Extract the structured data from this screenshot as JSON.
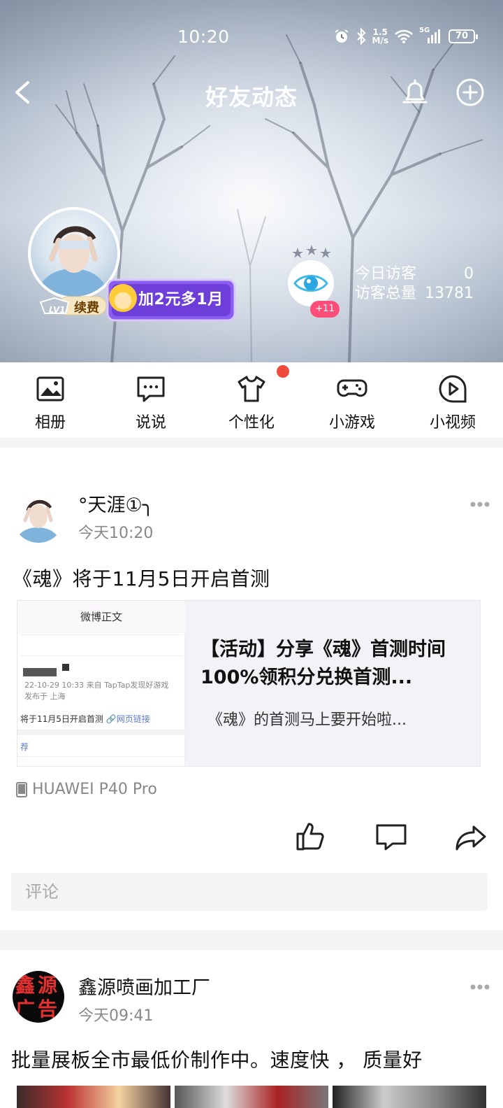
{
  "status_bar": {
    "time": "10:20",
    "speed_value": "1.5",
    "speed_unit": "M/s",
    "network": "5G",
    "battery": "70"
  },
  "nav": {
    "title": "好友动态"
  },
  "profile": {
    "level": "LV1",
    "renew_label": "续费",
    "promo_label": "加2元多1月",
    "visitor_plus": "+11",
    "today_visits_label": "今日访客",
    "today_visits_value": "0",
    "total_visits_label": "访客总量",
    "total_visits_value": "13781"
  },
  "quick_menu": [
    {
      "label": "相册",
      "icon": "photo-album-icon"
    },
    {
      "label": "说说",
      "icon": "chat-bubble-icon"
    },
    {
      "label": "个性化",
      "icon": "tshirt-icon"
    },
    {
      "label": "小游戏",
      "icon": "gamepad-icon"
    },
    {
      "label": "小视频",
      "icon": "video-play-icon"
    }
  ],
  "posts": [
    {
      "author": "°天涯①╮",
      "time": "今天10:20",
      "text": "《魂》将于11月5日开启首测",
      "card": {
        "thumb_header": "微博正文",
        "thumb_meta": "22-10-29 10:33 来自 TapTap发现好游戏",
        "thumb_location": "发布于 上海",
        "thumb_body": "将于11月5日开启首测",
        "thumb_link": "网页链接",
        "thumb_footer": "荐",
        "title": "【活动】分享《魂》首测时间 100%领积分兑换首测...",
        "desc": "《魂》的首测马上要开始啦..."
      },
      "device": "HUAWEI P40 Pro",
      "comment_placeholder": "评论"
    },
    {
      "author": "鑫源喷画加工厂",
      "time": "今天09:41",
      "avatar_text": "鑫源广告",
      "text": "批量展板全市最低价制作中。速度快 ， 质量好"
    }
  ],
  "colors": {
    "accent_red": "#f04a3c",
    "visitor_pink": "#ff4d79",
    "promo_purple": "#7a4fe0"
  }
}
